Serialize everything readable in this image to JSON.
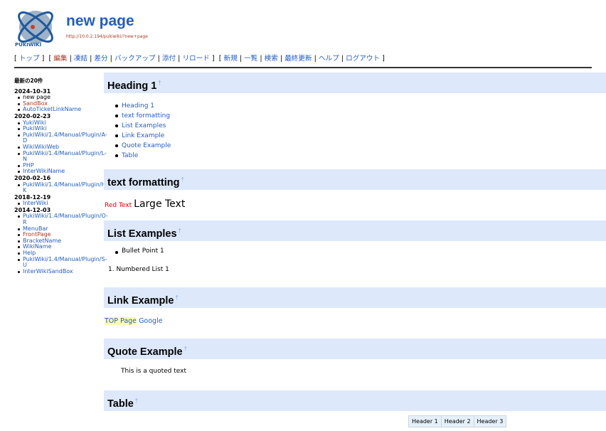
{
  "header": {
    "title": "new page",
    "url": "http://10.0.2.194/pukiwiki/?new+page",
    "logo_icon": "pukiwiki-logo",
    "logo_text": "PUKIWIKI"
  },
  "navigator": {
    "open": "[",
    "close": "]",
    "sep": "|",
    "top": "トップ",
    "edit": "編集",
    "freeze": "凍結",
    "diff": "差分",
    "backup": "バックアップ",
    "attach": "添付",
    "reload": "リロード",
    "new": "新規",
    "list": "一覧",
    "search": "検索",
    "recent": "最終更新",
    "help": "ヘルプ",
    "logout": "ログアウト"
  },
  "sidebar": {
    "title": "最新の20件",
    "groups": [
      {
        "date": "2024-10-31",
        "items": [
          "new page",
          "SandBox",
          "AutoTicketLinkName"
        ]
      },
      {
        "date": "2020-02-23",
        "items": [
          "YukiWiki",
          "PukiWiki",
          "PukiWiki/1.4/Manual/Plugin/A-D",
          "WikiWikiWeb",
          "PukiWiki/1.4/Manual/Plugin/L-N",
          "PHP",
          "InterWikiName"
        ]
      },
      {
        "date": "2020-02-16",
        "items": [
          "PukiWiki/1.4/Manual/Plugin/H-K"
        ]
      },
      {
        "date": "2018-12-19",
        "items": [
          "InterWiki"
        ]
      },
      {
        "date": "2014-12-03",
        "items": [
          "PukiWiki/1.4/Manual/Plugin/O-R",
          "MenuBar",
          "FrontPage",
          "BracketName",
          "WikiName",
          "Help",
          "PukiWiki/1.4/Manual/Plugin/S-U",
          "InterWikiSandBox"
        ]
      }
    ]
  },
  "main": {
    "anchor": "†",
    "h_heading1": "Heading 1",
    "contents": [
      "Heading 1",
      "text formatting",
      "List Examples",
      "Link Example",
      "Quote Example",
      "Table"
    ],
    "h_textfmt": "text formatting",
    "red_text": "Red Text",
    "large_text": "Large Text",
    "h_lists": "List Examples",
    "bullet_point": "Bullet Point 1",
    "numbered_item": "1. Numbered List 1",
    "h_link": "Link Example",
    "link_top": "TOP Page",
    "link_google": "Google",
    "h_quote": "Quote Example",
    "quote_text": "This is a quoted text",
    "h_table": "Table",
    "table_headers": [
      "Header 1",
      "Header 2",
      "Header 3"
    ]
  },
  "colors": {
    "link": "#215dc6",
    "visited": "#a63d21",
    "heading_bg": "#dde8fa",
    "red_text": "#e00000"
  }
}
